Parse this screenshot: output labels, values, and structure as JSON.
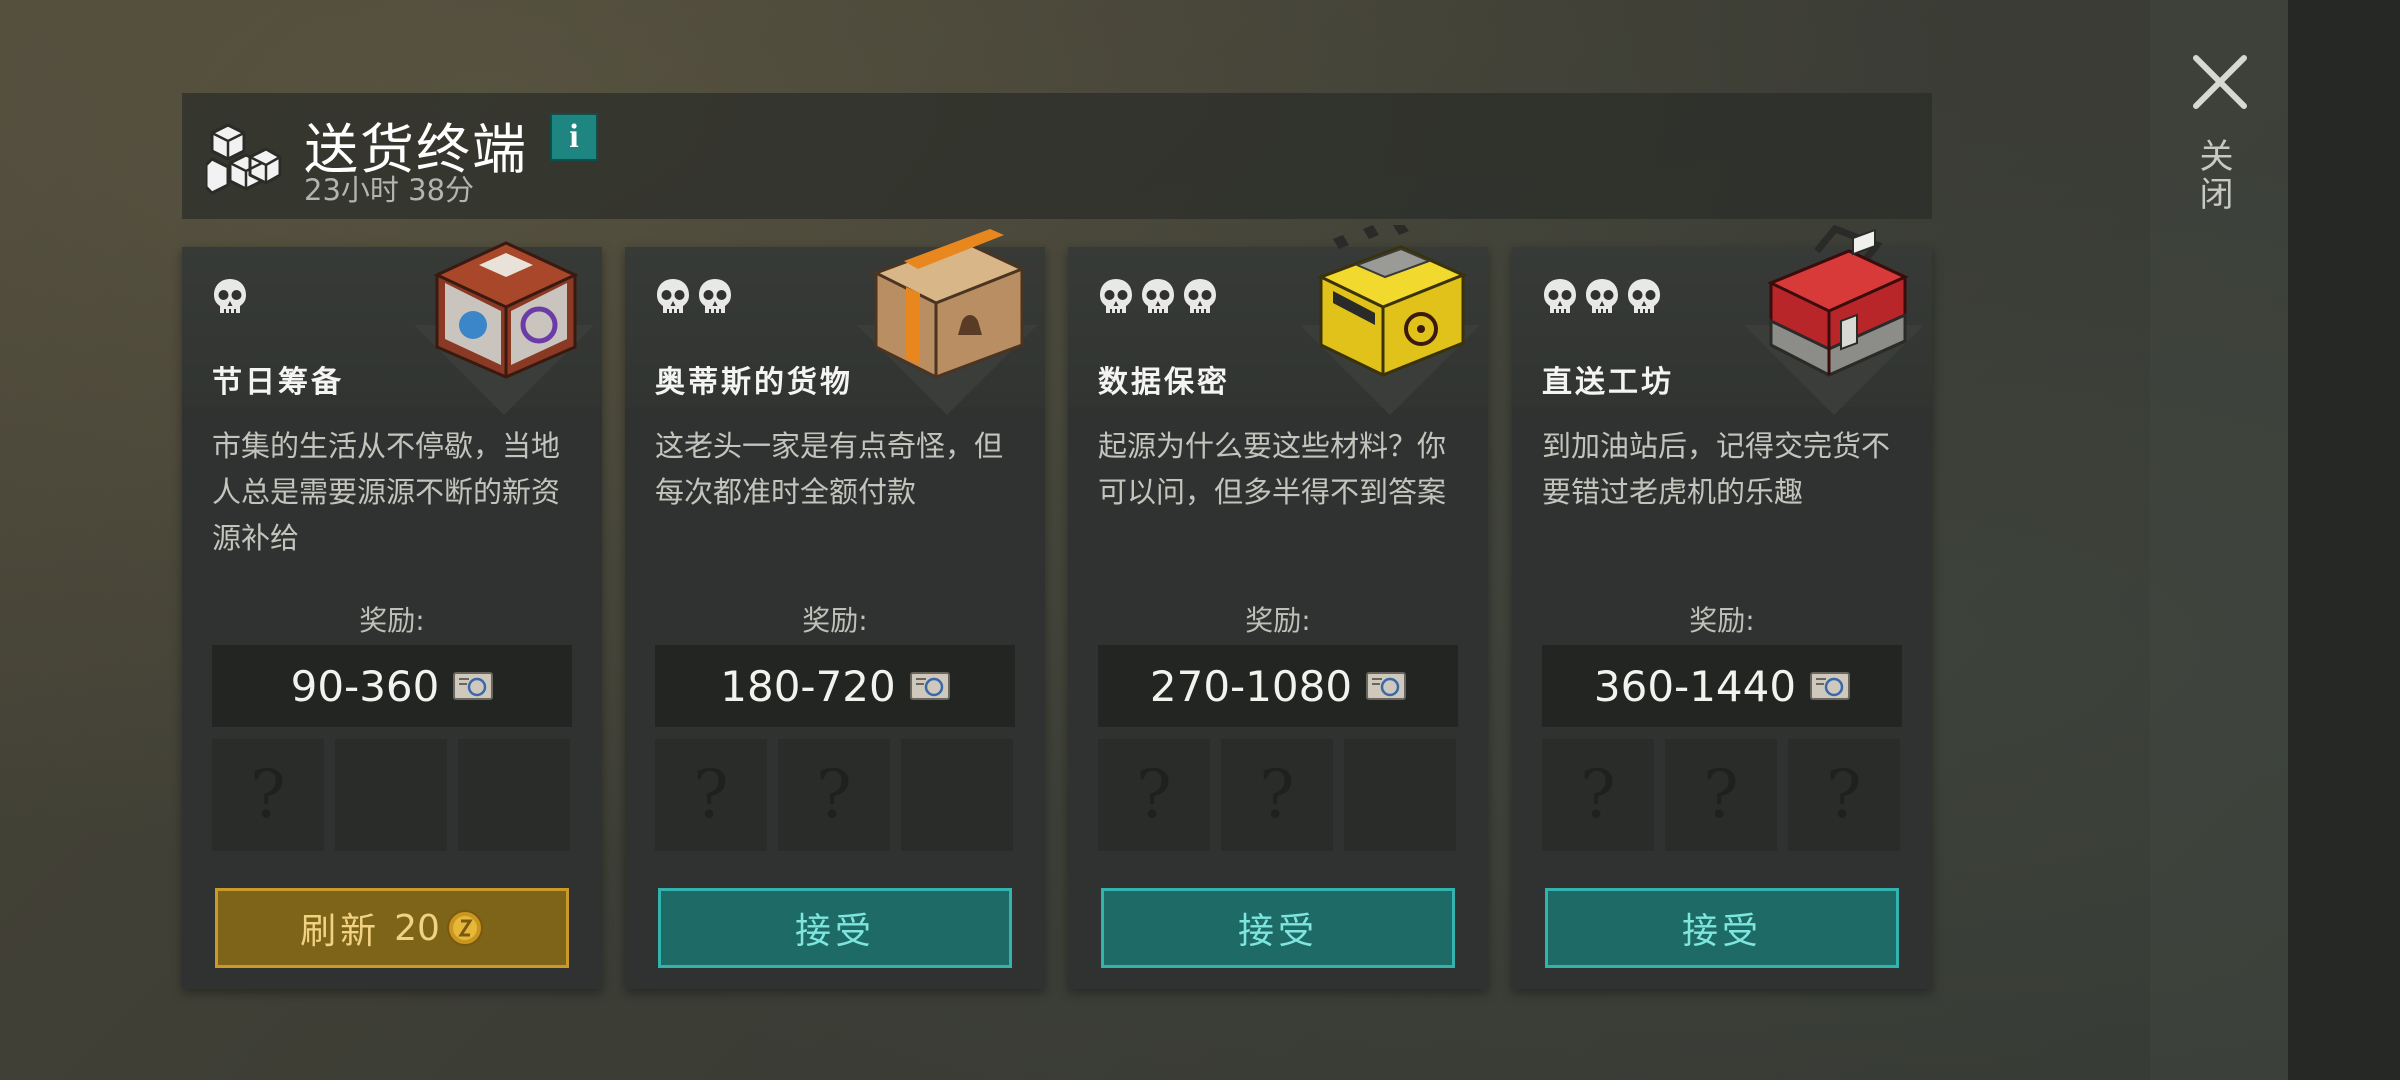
{
  "header": {
    "title": "送货终端",
    "info_label": "i",
    "timer": "23小时 38分",
    "logo_icon": "boxes-icon"
  },
  "close": {
    "label": "关闭",
    "icon": "close-icon"
  },
  "reward_label": "奖励:",
  "cards": [
    {
      "skulls": 1,
      "name": "节日筹备",
      "description": "市集的生活从不停歇，当地人总是需要源源不断的新资源补给",
      "reward": "90-360",
      "slots": [
        true,
        false,
        false
      ],
      "action": {
        "type": "refresh",
        "label": "刷新",
        "cost": "20"
      },
      "crate": "festival-crate-icon"
    },
    {
      "skulls": 2,
      "name": "奥蒂斯的货物",
      "description": "这老头一家是有点奇怪，但每次都准时全额付款",
      "reward": "180-720",
      "slots": [
        true,
        true,
        false
      ],
      "action": {
        "type": "accept",
        "label": "接受"
      },
      "crate": "cardboard-box-icon"
    },
    {
      "skulls": 3,
      "name": "数据保密",
      "description": "起源为什么要这些材料？你可以问，但多半得不到答案",
      "reward": "270-1080",
      "slots": [
        true,
        true,
        false
      ],
      "action": {
        "type": "accept",
        "label": "接受"
      },
      "crate": "biohazard-case-icon"
    },
    {
      "skulls": 3,
      "name": "直送工坊",
      "description": "到加油站后，记得交完货不要错过老虎机的乐趣",
      "reward": "360-1440",
      "slots": [
        true,
        true,
        true
      ],
      "action": {
        "type": "accept",
        "label": "接受"
      },
      "crate": "toolbox-icon"
    }
  ],
  "colors": {
    "accept_fill": "#1e6a66",
    "accept_border": "#32b3ad",
    "refresh_fill": "#7d6418",
    "refresh_border": "#c99a2a"
  }
}
